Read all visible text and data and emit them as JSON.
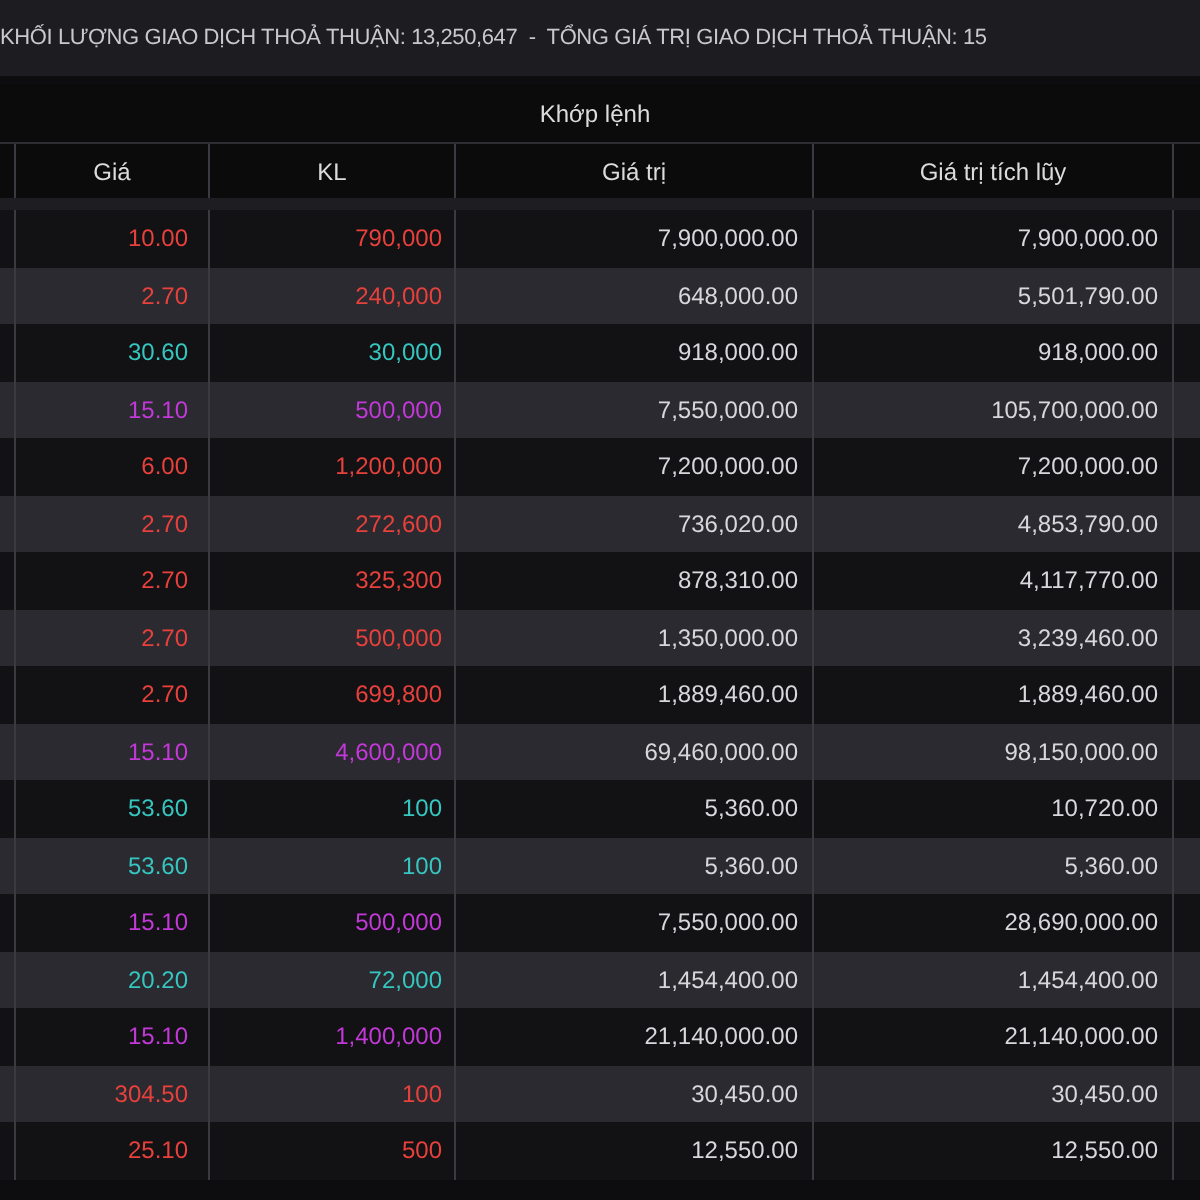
{
  "summary": "KHỐI LƯỢNG GIAO DỊCH THOẢ THUẬN: 13,250,647  -  TỔNG GIÁ TRỊ GIAO DỊCH THOẢ THUẬN: 15",
  "table": {
    "group_header": "Khớp lệnh",
    "columns": [
      "Giá",
      "KL",
      "Giá trị",
      "Giá trị tích lũy"
    ],
    "rows": [
      {
        "price": "10.00",
        "volume": "790,000",
        "value": "7,900,000.00",
        "cumulative": "7,900,000.00",
        "color": "#e8413c"
      },
      {
        "price": "2.70",
        "volume": "240,000",
        "value": "648,000.00",
        "cumulative": "5,501,790.00",
        "color": "#e8413c"
      },
      {
        "price": "30.60",
        "volume": "30,000",
        "value": "918,000.00",
        "cumulative": "918,000.00",
        "color": "#36c6c0"
      },
      {
        "price": "15.10",
        "volume": "500,000",
        "value": "7,550,000.00",
        "cumulative": "105,700,000.00",
        "color": "#c338d8"
      },
      {
        "price": "6.00",
        "volume": "1,200,000",
        "value": "7,200,000.00",
        "cumulative": "7,200,000.00",
        "color": "#e8413c"
      },
      {
        "price": "2.70",
        "volume": "272,600",
        "value": "736,020.00",
        "cumulative": "4,853,790.00",
        "color": "#e8413c"
      },
      {
        "price": "2.70",
        "volume": "325,300",
        "value": "878,310.00",
        "cumulative": "4,117,770.00",
        "color": "#e8413c"
      },
      {
        "price": "2.70",
        "volume": "500,000",
        "value": "1,350,000.00",
        "cumulative": "3,239,460.00",
        "color": "#e8413c"
      },
      {
        "price": "2.70",
        "volume": "699,800",
        "value": "1,889,460.00",
        "cumulative": "1,889,460.00",
        "color": "#e8413c"
      },
      {
        "price": "15.10",
        "volume": "4,600,000",
        "value": "69,460,000.00",
        "cumulative": "98,150,000.00",
        "color": "#c338d8"
      },
      {
        "price": "53.60",
        "volume": "100",
        "value": "5,360.00",
        "cumulative": "10,720.00",
        "color": "#36c6c0"
      },
      {
        "price": "53.60",
        "volume": "100",
        "value": "5,360.00",
        "cumulative": "5,360.00",
        "color": "#36c6c0"
      },
      {
        "price": "15.10",
        "volume": "500,000",
        "value": "7,550,000.00",
        "cumulative": "28,690,000.00",
        "color": "#c338d8"
      },
      {
        "price": "20.20",
        "volume": "72,000",
        "value": "1,454,400.00",
        "cumulative": "1,454,400.00",
        "color": "#36c6c0"
      },
      {
        "price": "15.10",
        "volume": "1,400,000",
        "value": "21,140,000.00",
        "cumulative": "21,140,000.00",
        "color": "#c338d8"
      },
      {
        "price": "304.50",
        "volume": "100",
        "value": "30,450.00",
        "cumulative": "30,450.00",
        "color": "#e8413c"
      },
      {
        "price": "25.10",
        "volume": "500",
        "value": "12,550.00",
        "cumulative": "12,550.00",
        "color": "#e8413c"
      }
    ]
  }
}
